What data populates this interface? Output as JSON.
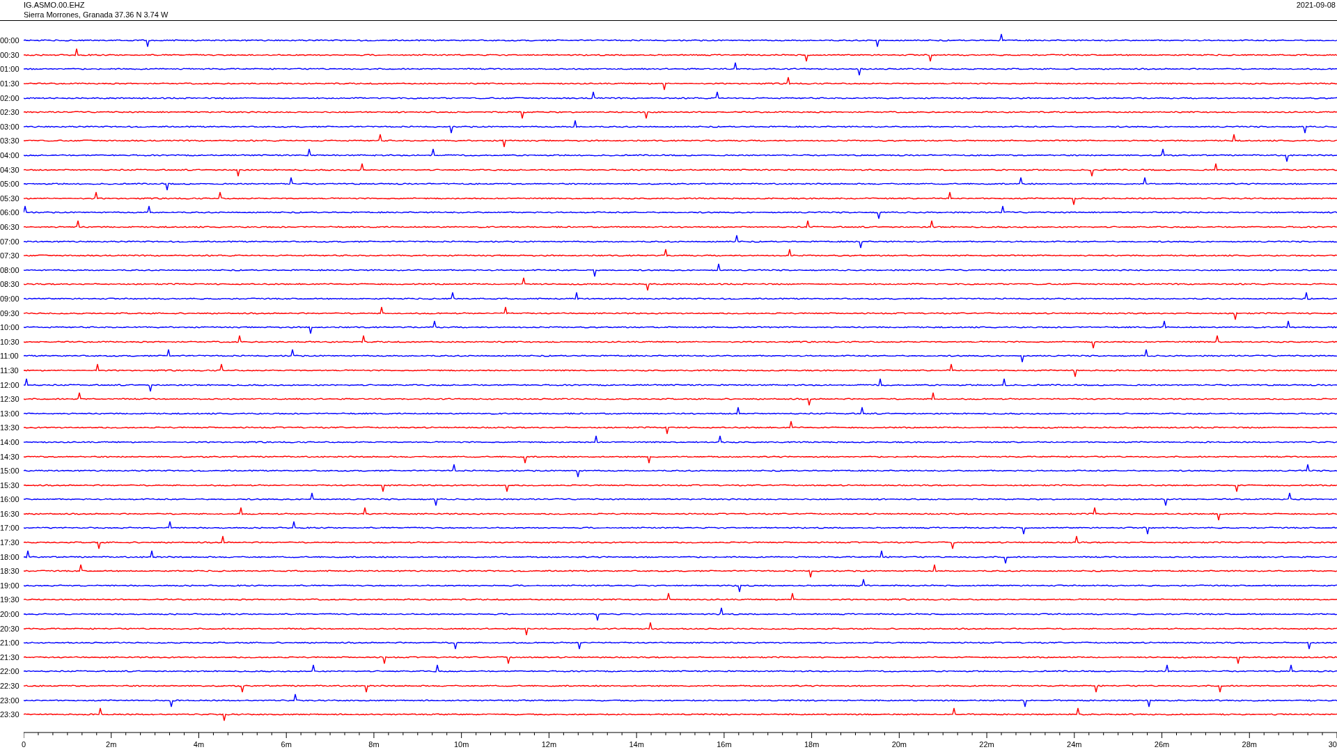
{
  "header": {
    "station": "IG.ASMO.00.EHZ",
    "location": "Sierra Morrones, Granada  37.36 N 3.74 W",
    "date": "2021-09-08"
  },
  "traces": [
    {
      "time": "00:00",
      "color": "#0000ff"
    },
    {
      "time": "00:30",
      "color": "#ff0000"
    },
    {
      "time": "01:00",
      "color": "#0000ff"
    },
    {
      "time": "01:30",
      "color": "#ff0000"
    },
    {
      "time": "02:00",
      "color": "#0000ff"
    },
    {
      "time": "02:30",
      "color": "#ff0000"
    },
    {
      "time": "03:00",
      "color": "#0000ff"
    },
    {
      "time": "03:30",
      "color": "#ff0000"
    },
    {
      "time": "04:00",
      "color": "#0000ff"
    },
    {
      "time": "04:30",
      "color": "#ff0000"
    },
    {
      "time": "05:00",
      "color": "#0000ff"
    },
    {
      "time": "05:30",
      "color": "#ff0000"
    },
    {
      "time": "06:00",
      "color": "#0000ff"
    },
    {
      "time": "06:30",
      "color": "#ff0000"
    },
    {
      "time": "07:00",
      "color": "#0000ff"
    },
    {
      "time": "07:30",
      "color": "#ff0000"
    },
    {
      "time": "08:00",
      "color": "#0000ff"
    },
    {
      "time": "08:30",
      "color": "#ff0000"
    },
    {
      "time": "09:00",
      "color": "#0000ff"
    },
    {
      "time": "09:30",
      "color": "#ff0000"
    },
    {
      "time": "10:00",
      "color": "#0000ff"
    },
    {
      "time": "10:30",
      "color": "#ff0000"
    },
    {
      "time": "11:00",
      "color": "#0000ff"
    },
    {
      "time": "11:30",
      "color": "#ff0000"
    },
    {
      "time": "12:00",
      "color": "#0000ff"
    },
    {
      "time": "12:30",
      "color": "#ff0000"
    },
    {
      "time": "13:00",
      "color": "#0000ff"
    },
    {
      "time": "13:30",
      "color": "#ff0000"
    },
    {
      "time": "14:00",
      "color": "#0000ff"
    },
    {
      "time": "14:30",
      "color": "#ff0000"
    },
    {
      "time": "15:00",
      "color": "#0000ff"
    },
    {
      "time": "15:30",
      "color": "#ff0000"
    },
    {
      "time": "16:00",
      "color": "#0000ff"
    },
    {
      "time": "16:30",
      "color": "#ff0000"
    },
    {
      "time": "17:00",
      "color": "#0000ff"
    },
    {
      "time": "17:30",
      "color": "#ff0000"
    },
    {
      "time": "18:00",
      "color": "#0000ff"
    },
    {
      "time": "18:30",
      "color": "#ff0000"
    },
    {
      "time": "19:00",
      "color": "#0000ff"
    },
    {
      "time": "19:30",
      "color": "#ff0000"
    },
    {
      "time": "20:00",
      "color": "#0000ff"
    },
    {
      "time": "20:30",
      "color": "#ff0000"
    },
    {
      "time": "21:00",
      "color": "#0000ff"
    },
    {
      "time": "21:30",
      "color": "#ff0000"
    },
    {
      "time": "22:00",
      "color": "#0000ff"
    },
    {
      "time": "22:30",
      "color": "#ff0000"
    },
    {
      "time": "23:00",
      "color": "#0000ff"
    },
    {
      "time": "23:30",
      "color": "#ff0000"
    }
  ],
  "axis": {
    "tick_labels": [
      "0",
      "2m",
      "4m",
      "6m",
      "8m",
      "10m",
      "12m",
      "14m",
      "16m",
      "18m",
      "20m",
      "22m",
      "24m",
      "26m",
      "28m",
      "30"
    ]
  }
}
